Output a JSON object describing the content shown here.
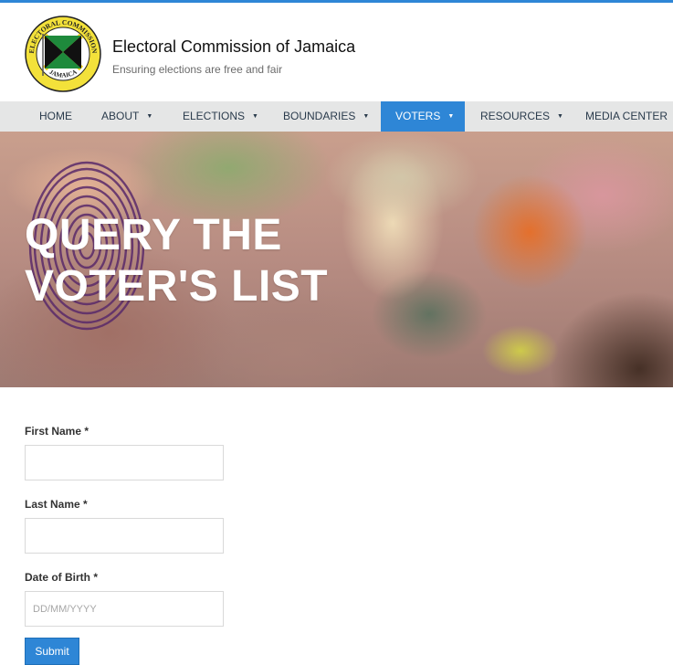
{
  "header": {
    "title": "Electoral Commission of Jamaica",
    "tagline": "Ensuring elections are free and fair",
    "logo_text_top": "ELECTORAL COMMISSION",
    "logo_text_bottom": "JAMAICA"
  },
  "nav": {
    "items": [
      {
        "label": "HOME",
        "has_caret": false
      },
      {
        "label": "ABOUT",
        "has_caret": true
      },
      {
        "label": "ELECTIONS",
        "has_caret": true
      },
      {
        "label": "BOUNDARIES",
        "has_caret": true
      },
      {
        "label": "VOTERS",
        "has_caret": true,
        "active": true
      },
      {
        "label": "RESOURCES",
        "has_caret": true
      },
      {
        "label": "MEDIA CENTER",
        "has_caret": true
      }
    ],
    "caret": "▼"
  },
  "hero": {
    "title_line1": "QUERY THE",
    "title_line2": "VOTER'S LIST"
  },
  "form": {
    "first_name_label": "First Name *",
    "last_name_label": "Last Name *",
    "dob_label": "Date of Birth *",
    "dob_placeholder": "DD/MM/YYYY",
    "submit_label": "Submit"
  },
  "colors": {
    "accent": "#2e86d6",
    "nav_bg": "#e5e6e6",
    "nav_text": "#2a3b4c"
  }
}
